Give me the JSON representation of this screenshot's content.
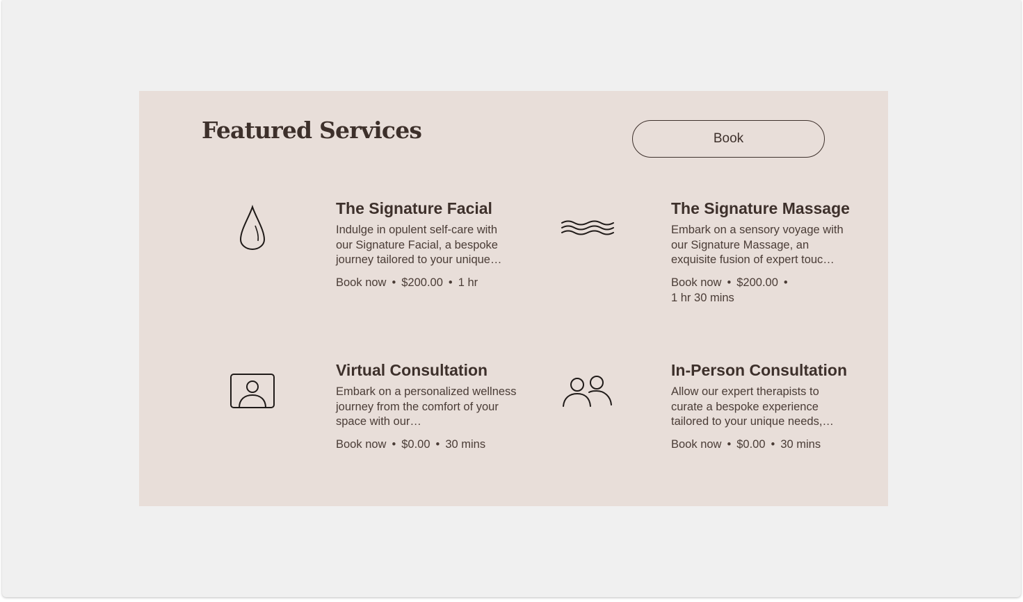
{
  "header": {
    "title": "Featured Services",
    "book_label": "Book"
  },
  "services": [
    {
      "title": "The Signature Facial",
      "description": "Indulge in opulent self-care with our Signature Facial, a bespoke journey tailored to your unique…",
      "book_label": "Book now",
      "price": "$200.00",
      "duration": "1 hr",
      "icon": "droplet-icon"
    },
    {
      "title": "The Signature Massage",
      "description": "Embark on a sensory voyage with our Signature Massage, an exquisite fusion of expert touc…",
      "book_label": "Book now",
      "price": "$200.00",
      "duration": "1 hr 30 mins",
      "icon": "waves-icon"
    },
    {
      "title": "Virtual Consultation",
      "description": "Embark on a personalized wellness journey from the comfort of your space with our…",
      "book_label": "Book now",
      "price": "$0.00",
      "duration": "30 mins",
      "icon": "video-call-icon"
    },
    {
      "title": "In-Person Consultation",
      "description": "Allow our expert therapists to curate a bespoke experience tailored to your unique needs,…",
      "book_label": "Book now",
      "price": "$0.00",
      "duration": "30 mins",
      "icon": "people-icon"
    }
  ],
  "colors": {
    "page_background": "#f0f0f0",
    "panel_background": "#e8ded9",
    "text": "#3d302b"
  }
}
